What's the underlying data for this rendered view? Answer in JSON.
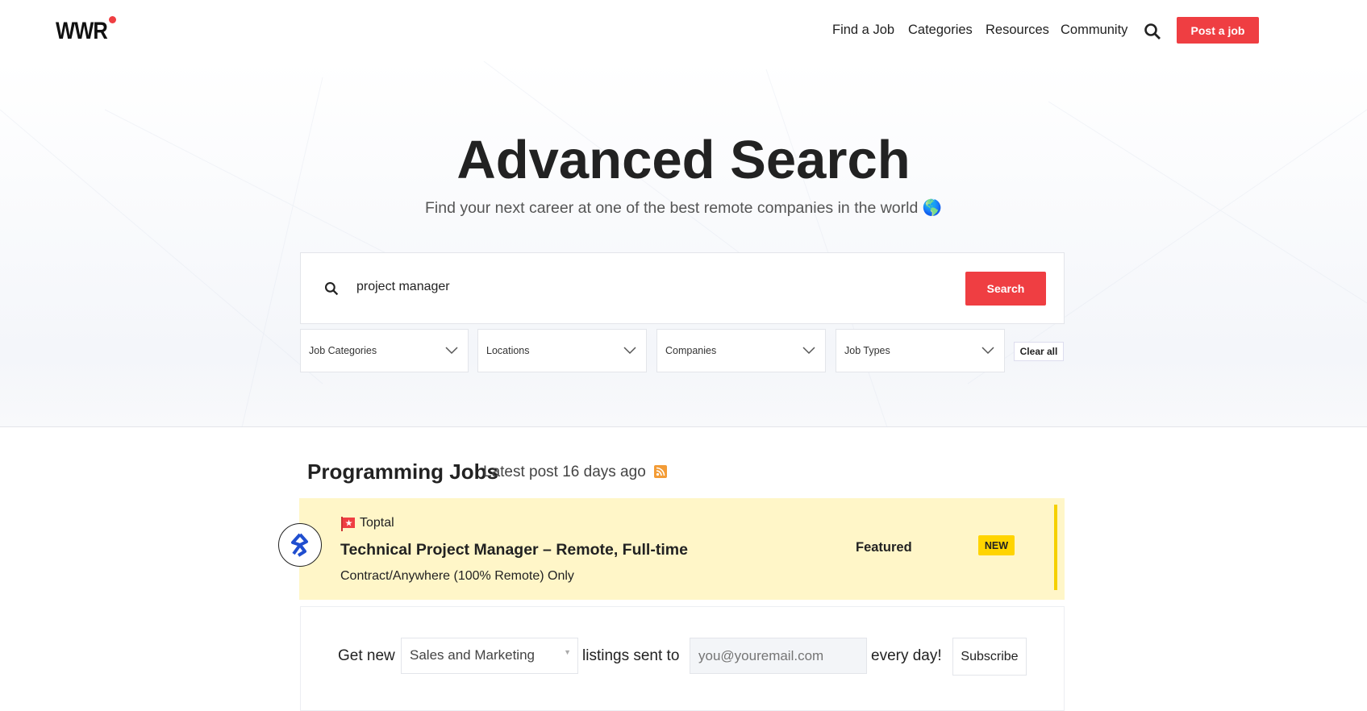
{
  "header": {
    "logo": "WWR",
    "nav": [
      "Find a Job",
      "Categories",
      "Resources",
      "Community"
    ],
    "post_job": "Post a job"
  },
  "hero": {
    "title": "Advanced Search",
    "subtitle": "Find your next career at one of the best remote companies in the world 🌎",
    "search": {
      "value": "project manager",
      "button": "Search"
    },
    "filters": [
      "Job Categories",
      "Locations",
      "Companies",
      "Job Types"
    ],
    "clear_all": "Clear all"
  },
  "section": {
    "title": "Programming Jobs",
    "latest": "Latest post 16 days ago"
  },
  "job": {
    "company": "Toptal",
    "title": "Technical Project Manager – Remote, Full-time",
    "region": "Contract/Anywhere (100% Remote) Only",
    "featured": "Featured",
    "badge": "NEW"
  },
  "subscribe": {
    "get_new": "Get new",
    "category": "Sales and Marketing",
    "listings_sent_to": "listings sent to",
    "email_placeholder": "you@youremail.com",
    "every_day": "every day!",
    "button": "Subscribe"
  },
  "colors": {
    "accent": "#ef3e42",
    "featured_bg": "#fff6c8",
    "badge": "#ffd400"
  }
}
